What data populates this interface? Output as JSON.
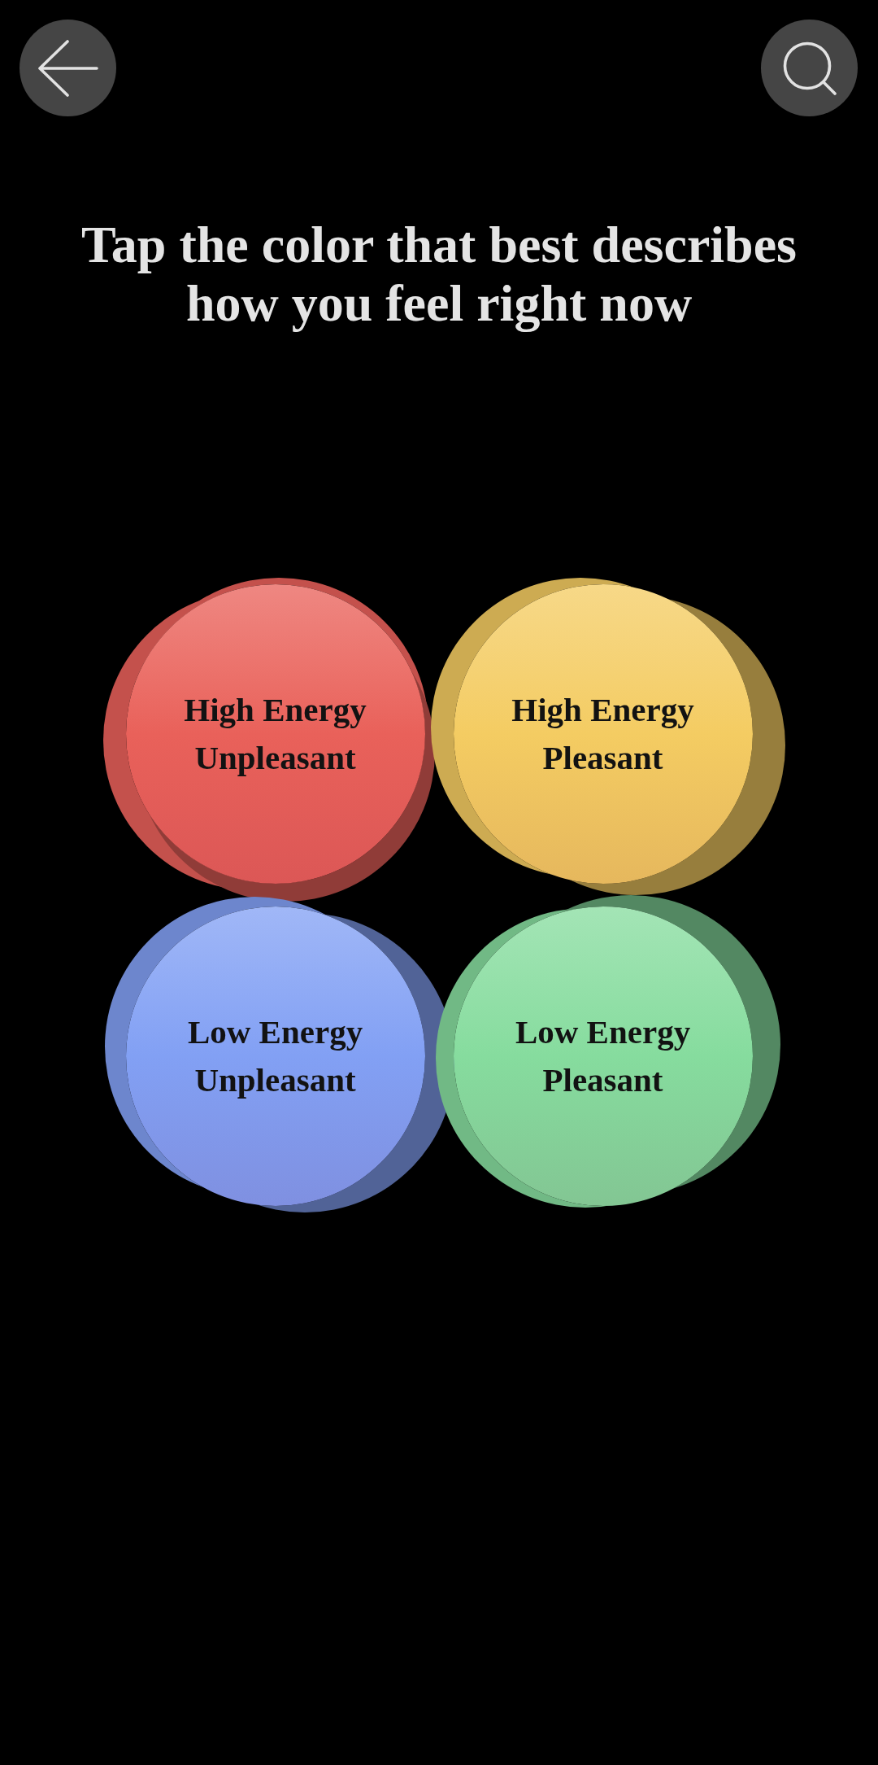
{
  "prompt": "Tap the color that best describes how you feel right now",
  "moods": [
    {
      "label": "High Energy Unpleasant",
      "color": "#e9615a"
    },
    {
      "label": "High Energy Pleasant",
      "color": "#f4cc62"
    },
    {
      "label": "Low Energy Unpleasant",
      "color": "#82a0f4"
    },
    {
      "label": "Low Energy Pleasant",
      "color": "#86dc9e"
    }
  ]
}
